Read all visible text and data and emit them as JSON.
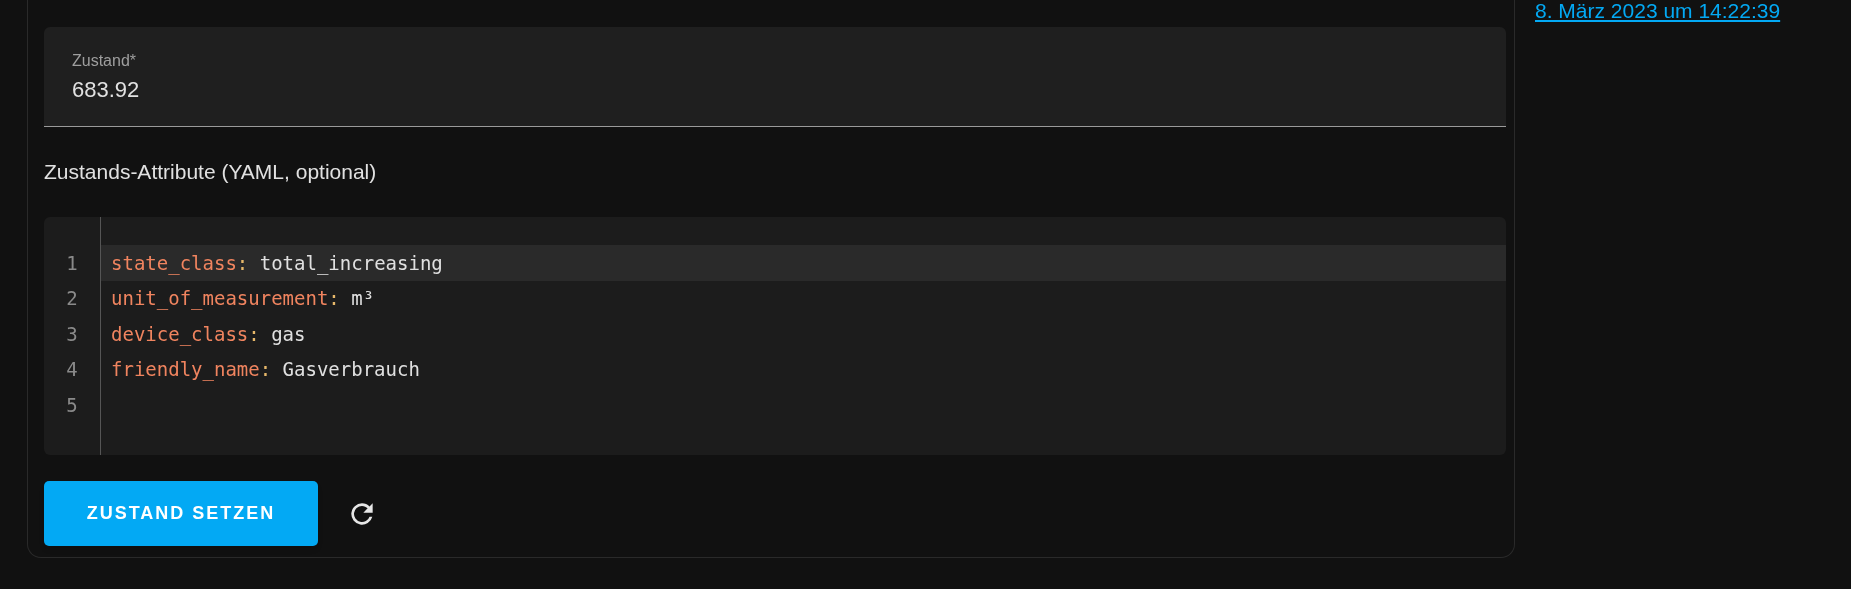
{
  "timestamp_link": "8. März 2023 um 14:22:39",
  "state_field": {
    "label": "Zustand*",
    "value": "683.92"
  },
  "attributes_heading": "Zustands-Attribute (YAML, optional)",
  "editor": {
    "lines": [
      {
        "number": "1",
        "key": "state_class",
        "separator": ":",
        "value": "total_increasing",
        "active": true
      },
      {
        "number": "2",
        "key": "unit_of_measurement",
        "separator": ":",
        "value": "m³",
        "active": false
      },
      {
        "number": "3",
        "key": "device_class",
        "separator": ":",
        "value": "gas",
        "active": false
      },
      {
        "number": "4",
        "key": "friendly_name",
        "separator": ":",
        "value": "Gasverbrauch",
        "active": false
      },
      {
        "number": "5",
        "active": false
      }
    ]
  },
  "set_state_button": "ZUSTAND SETZEN"
}
